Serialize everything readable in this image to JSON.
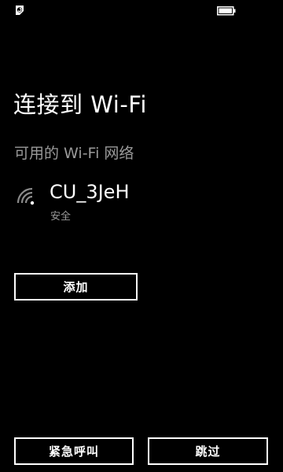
{
  "status_bar": {
    "left_icon": "data-sense-icon",
    "right_icon": "battery-icon"
  },
  "page": {
    "title": "连接到 Wi-Fi",
    "section_header": "可用的 Wi-Fi 网络"
  },
  "networks": [
    {
      "name": "CU_3JeH",
      "security": "安全",
      "icon": "wifi-signal-icon"
    }
  ],
  "buttons": {
    "add": "添加",
    "emergency_call": "紧急呼叫",
    "skip": "跳过"
  },
  "colors": {
    "background": "#000000",
    "text": "#ffffff",
    "subtext": "#9a9a9a"
  }
}
